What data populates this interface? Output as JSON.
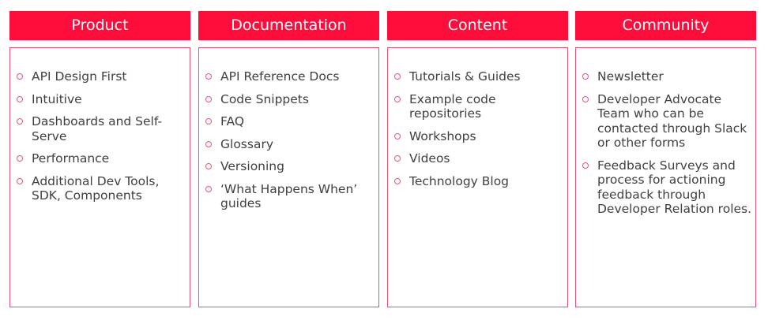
{
  "columns": [
    {
      "title": "Product",
      "items": [
        "API Design First",
        "Intuitive",
        "Dashboards and Self-Serve",
        "Performance",
        "Additional Dev Tools, SDK, Components"
      ]
    },
    {
      "title": "Documentation",
      "items": [
        "API Reference Docs",
        "Code Snippets",
        "FAQ",
        "Glossary",
        "Versioning",
        "‘What Happens When’ guides"
      ]
    },
    {
      "title": "Content",
      "items": [
        "Tutorials & Guides",
        "Example code repositories",
        "Workshops",
        "Videos",
        "Technology Blog"
      ]
    },
    {
      "title": "Community",
      "items": [
        "Newsletter",
        "Developer Advocate Team who can be contacted through Slack or other forms",
        "Feedback Surveys and process for actioning feedback through Developer Relation roles."
      ]
    }
  ],
  "colors": {
    "header_background": "#ff0d3a",
    "header_text": "#ffffff",
    "box_border": "#e8506b",
    "bullet": "#e05a72",
    "item_text": "#404040"
  }
}
